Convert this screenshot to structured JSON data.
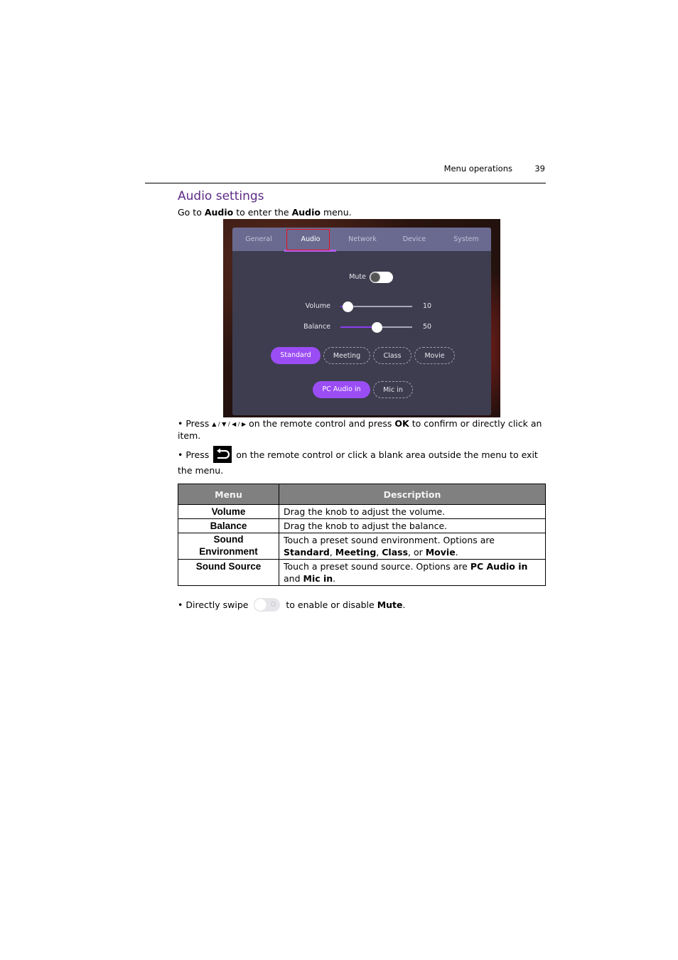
{
  "header": {
    "section": "Menu operations",
    "page_number": "39"
  },
  "title": "Audio settings",
  "intro": {
    "pre": "Go to ",
    "b1": "Audio",
    "mid": " to enter the ",
    "b2": "Audio",
    "post": " menu."
  },
  "screenshot": {
    "tabs": [
      {
        "label": "General",
        "active": false
      },
      {
        "label": "Audio",
        "active": true
      },
      {
        "label": "Network",
        "active": false
      },
      {
        "label": "Device",
        "active": false
      },
      {
        "label": "System",
        "active": false
      }
    ],
    "mute": {
      "label": "Mute",
      "state": "off"
    },
    "volume": {
      "label": "Volume",
      "value": "10"
    },
    "balance": {
      "label": "Balance",
      "value": "50"
    },
    "sound_environment": [
      "Standard",
      "Meeting",
      "Class",
      "Movie"
    ],
    "sound_environment_selected": "Standard",
    "sound_source": [
      "PC Audio in",
      "Mic in"
    ],
    "sound_source_selected": "PC Audio in",
    "colors": {
      "accent": "#9b4df5",
      "panel": "#3d3d4f",
      "tabbar": "#6a6a91",
      "highlight": "#e8101c"
    }
  },
  "bullets": {
    "b1": {
      "pre": "Press ",
      "arrows": "▲ / ▼ / ◀ / ▶",
      "mid": " on the remote control and press ",
      "ok": "OK",
      "post": " to confirm or directly click an item."
    },
    "b2": {
      "pre": "Press ",
      "post": " on the remote control or click a blank area outside the menu to exit the menu."
    },
    "b3": {
      "pre": "Directly swipe ",
      "mid": " to enable or disable ",
      "mute": "Mute",
      "post": "."
    }
  },
  "table": {
    "headers": [
      "Menu",
      "Description"
    ],
    "rows": [
      {
        "menu": "Volume",
        "desc": "Drag the knob to adjust the volume."
      },
      {
        "menu": "Balance",
        "desc": "Drag the knob to adjust the balance."
      },
      {
        "menu": "Sound Environment",
        "desc_pre": "Touch a preset sound environment. Options are ",
        "opts": [
          "Standard",
          "Meeting",
          "Class",
          "Movie"
        ],
        "sep1": ", ",
        "sep2": ", ",
        "sep3": ", or ",
        "end": "."
      },
      {
        "menu": "Sound Source",
        "desc_pre": "Touch a preset sound source. Options are ",
        "opts": [
          "PC Audio in",
          "Mic in"
        ],
        "sep1": " and ",
        "end": "."
      }
    ]
  }
}
